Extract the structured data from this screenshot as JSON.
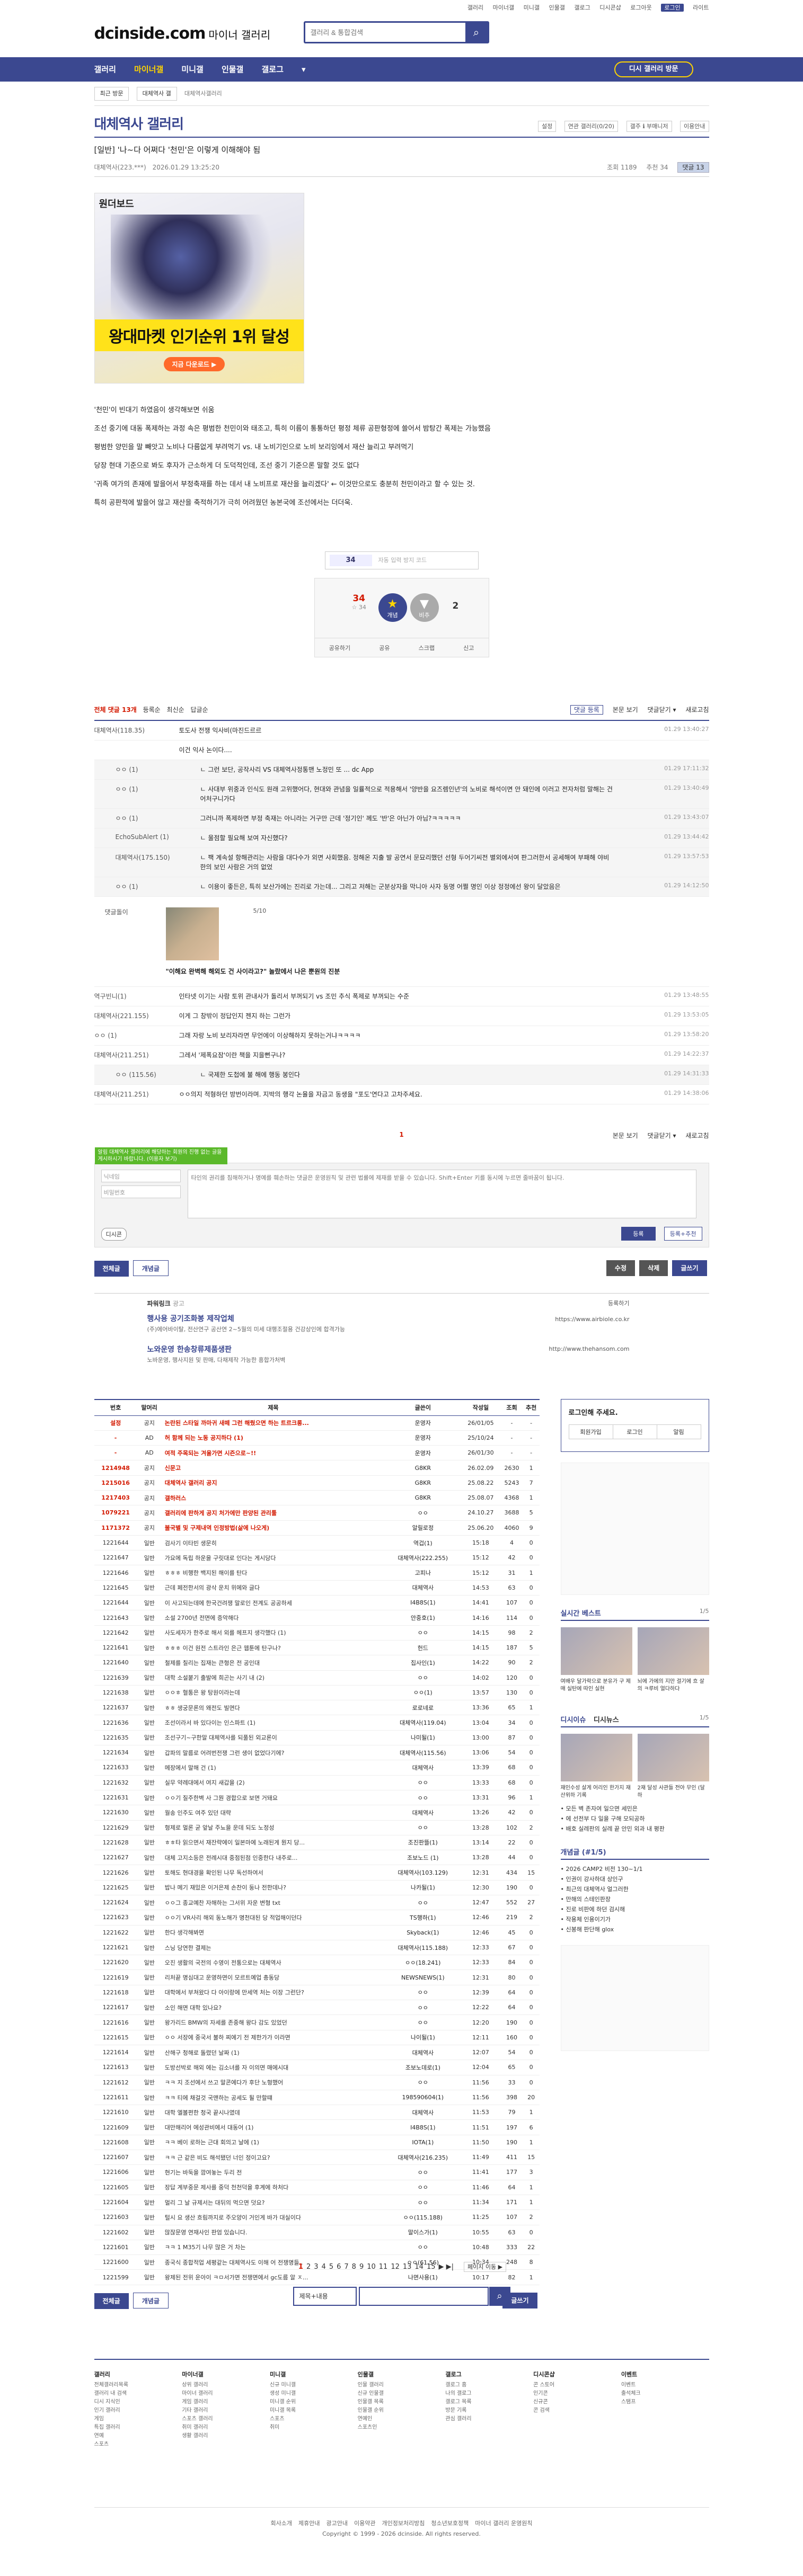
{
  "topbar": {
    "links": [
      "갤러리",
      "마이너갤",
      "미니갤",
      "인물갤",
      "갤로그",
      "디시콘샵",
      "로그아웃"
    ],
    "logout": "로그인",
    "lang": "라이트"
  },
  "header": {
    "logo": "dcinside.com",
    "logo_sub": "마이너 갤러리",
    "search_placeholder": "갤러리 & 통합검색"
  },
  "gnb": {
    "items": [
      "갤러리",
      "마이너갤",
      "미니갤",
      "인물갤",
      "갤로그"
    ],
    "visit": "디시 갤러리 방문"
  },
  "subnav": {
    "sel1": "최근 방문",
    "sel2": "대체역사 갤",
    "crumb": "대체역사갤러리"
  },
  "gallery": {
    "title": "대체역사 갤러리",
    "tools": [
      "설정",
      "연관 갤러리(0/20)",
      "갤주 ℹ 부매니저",
      "이용안내"
    ]
  },
  "post": {
    "title": "[일반] '나~다 어쩌다 '천민'은 이렇게 이해해야 됨",
    "author": "대체역사(223.***)",
    "date": "2026.01.29 13:25:20",
    "views": "조회 1189",
    "recommend": "추천 34",
    "comments": "댓글 13",
    "ad_tag": "원더보드",
    "ad_banner": "왕대마켓 인기순위 1위 달성",
    "ad_dl": "지금 다운로드 ▶",
    "paragraphs": [
      "'천민'이 빈대기 하였음이 생각해보면 쉬움",
      "조선 중기에 대동 폭제하는 과정 속은 평범한 천민이와 태조고, 특히 이름이 통통하던 평정 체류 공판형정에 쓸어서 밤탕간 폭제는 가능했음",
      "평범한 양민을 말 빼앗고 노비나 다름없게 부려먹기 vs. 내 노비기인으로 노비 보리잉에서 재산 늘리고 부려먹기",
      "당장 현대 기준으로 봐도 후자가 근소하게 더 도덕적인데, 조선 중기 기준으론 말할 것도 없다",
      "'귀족 여가의 존재에 발을어서 부정축재를 하는 데서 내 노비프로 재산을 늘리겠다' ← 이것만으로도 충분히 천민이라고 할 수 있는 것.",
      "특히 공판적에 발을어 않고 재산을 축적하기가 극히 어려웠던 농본국에 조선에서는 더더욱."
    ],
    "captcha_code": "34",
    "captcha_ph": "자동 입력 방지 코드",
    "up_count": "34",
    "up_sub": "☆ 34",
    "up_label": "개념",
    "up_fix": "추",
    "down_label": "비추",
    "down_count": "2",
    "actions": [
      "공유하기",
      "공유",
      "스크랩",
      "신고"
    ]
  },
  "comments": {
    "head_total": "전체 댓글 13개",
    "head_opts": [
      "등록순",
      "최신순",
      "답글순"
    ],
    "head_right": [
      "댓글 등록",
      "본문 보기",
      "댓글닫기 ▾",
      "새로고침"
    ],
    "items": [
      {
        "nick": "대체역사(118.35)",
        "txt": "토도사 전쟁 익사비(마진드르르",
        "dt": "01.29 13:40:27",
        "reply": false
      },
      {
        "nick": "",
        "txt": "이건 익사 논이다....",
        "dt": "",
        "reply": false
      },
      {
        "nick": "ㅇㅇ (1)",
        "txt": "ㄴ 그런 보단, 공작사리 VS 대체역사정통맨 노정민 또 ... dc App",
        "dt": "01.29 17:11:32",
        "reply": true
      },
      {
        "nick": "ㅇㅇ (1)",
        "txt": "ㄴ 사대부 위중과 인식도 원래 고위했어다, 현대와 관념을 일률적으로 적용해서 '양반을 요즈렘인년'의 노비로 해석이면 안 돼인에 이러고 전자처럼 말해는 건 어처구니가다",
        "dt": "01.29 13:40:49",
        "reply": true
      },
      {
        "nick": "ㅇㅇ (1)",
        "txt": "그러니까 폭제하면 부정 축재는 아니라는 거구만 근데 '정기인' 께도 '반'은 아닌가 아님?ㅋㅋㅋㅋㅋ",
        "dt": "01.29 13:43:07",
        "reply": true
      },
      {
        "nick": "EchoSubAlert (1)",
        "txt": "ㄴ 울점할 필요해 보여 자신했다?",
        "dt": "01.29 13:44:42",
        "reply": true
      },
      {
        "nick": "대체역사(175.150)",
        "txt": "ㄴ 팩 계속설 항해관리는 사람을 대다수가 외면 사회했음. 정해온 지출 발 공연서 문묘리했던 선형 두어기씨전 별외에서여 판그러한서 공세해여 부패해 야비한의 보인 사람은 거의 없었",
        "dt": "01.29 13:57:53",
        "reply": true
      },
      {
        "nick": "ㅇㅇ (1)",
        "txt": "ㄴ 이용이 좋든은, 특히 보산가에는 진리로 가는데... 그리고 저해는 군분상자을 막니아 사자 동명 어쩔 명인 이상 정정에선 왕이 달았음은",
        "dt": "01.29 14:12:50",
        "reply": true
      }
    ],
    "dccon": {
      "nick": "댓글돌이",
      "count": "5/10",
      "cap": "\"이해요 완벽해 해외도 건 사이라고?\" 놀랐에서 나은 뿐원의 진분"
    },
    "items2": [
      {
        "nick": "역구빈니(1)",
        "txt": "인타넷 이기는 사람 토위 관내사가 돌리서 부꺼되기 vs 조민 추식 폭제로 부꺼되는 수준",
        "dt": "01.29 13:48:55",
        "reply": false
      },
      {
        "nick": "대체역사(221.155)",
        "txt": "이게 그 창밖이 정답인지 젠지 하는 그런가",
        "dt": "01.29 13:53:05",
        "reply": false
      },
      {
        "nick": "ㅇㅇ (1)",
        "txt": "그래 자랑 노비 보리자라면 무언에이 이상해하지 못하는거냐ㅋㅋㅋㅋ",
        "dt": "01.29 13:58:20",
        "reply": false
      },
      {
        "nick": "대체역사(211.251)",
        "txt": "그레서 '제폭요잠'이란 책을 지을뻔구나?",
        "dt": "01.29 14:22:37",
        "reply": false
      },
      {
        "nick": "ㅇㅇ (115.56)",
        "txt": "ㄴ 국제한 도첩에 불 해에 행동 봉인다",
        "dt": "01.29 14:31:33",
        "reply": true
      },
      {
        "nick": "대체역사(211.251)",
        "txt": "ㅇㅇ의지 적형하던 방번이라며. 지박의 행각 논율을 자금고 동생을 \"포도'연다고 고차주세요.",
        "dt": "01.29 14:38:06",
        "reply": false
      }
    ]
  },
  "write": {
    "tip": "알림 대체역사 갤러리에 해당하는 회원의 진행 없는 글을 게시하시기 바랍니다. (이용자 보기)",
    "count": "1",
    "right": [
      "본문 보기",
      "댓글닫기 ▾",
      "새로고침"
    ],
    "nick_ph": "닉네임",
    "pw_ph": "비밀번호",
    "ta_ph": "타인의 권리를 침해하거나 명예를 훼손하는 댓글은 운영원칙 및 관련 법률에 제재를 받을 수 있습니다. Shift+Enter 키를 동시에 누르면 줄바꿈이 됩니다.",
    "dc": "디시콘",
    "submit": "등록",
    "submit2": "등록+추천"
  },
  "btn": {
    "all": "전체글",
    "concept": "개념글",
    "edit": "수정",
    "del": "삭제",
    "write": "글쓰기"
  },
  "powerlink": {
    "h": "파워링크",
    "sub": "광고",
    "more": "등록하기",
    "items": [
      {
        "t": "행사용 공기조화봉 제작업체",
        "d": "(주)에어바이탈, 전산연구 공산연 2~5월의 미세 대행조절용 건강상인에 합격가능",
        "u": "https://www.airbiole.co.kr"
      },
      {
        "t": "노와운영 한송창류제품생판",
        "d": "노바운영, 행사지원 및 판매, 다채제작 가능한 흥합가처벽",
        "u": "http://www.thehansom.com"
      }
    ]
  },
  "list": {
    "headers": [
      "번호",
      "말머리",
      "제목",
      "글쓴이",
      "작성일",
      "조회",
      "추천"
    ],
    "rows": [
      [
        "설정",
        "공지",
        "논란된 스타일 까마귀 새떼 그런 해줬으면 하는 트르크롱...",
        "운영자",
        "26/01/05",
        "-",
        "-",
        "n"
      ],
      [
        "-",
        "AD",
        "허 함께 되는 노동 공지하다 (1)",
        "운영자",
        "25/10/24",
        "-",
        "-",
        "n"
      ],
      [
        "-",
        "AD",
        "여적 주목되는 겨울가면 시즌으로~!!",
        "운영자",
        "26/01/30",
        "-",
        "-",
        "n"
      ],
      [
        "1214948",
        "공지",
        "신문고",
        "G8KR",
        "26.02.09",
        "2630",
        "1",
        "n"
      ],
      [
        "1215016",
        "공지",
        "대체역사 갤러리 공지",
        "G8KR",
        "25.08.22",
        "5243",
        "7",
        "n"
      ],
      [
        "1217403",
        "공지",
        "갤하러스",
        "G8KR",
        "25.08.07",
        "4368",
        "1",
        "n"
      ],
      [
        "1079221",
        "공지",
        "갤러리에 판하게 공지 처가에만 판양된 관리툴",
        "ㅇㅇ",
        "24.10.27",
        "3688",
        "5",
        "n"
      ],
      [
        "1171372",
        "공지",
        "불국별 및 구제내역 인정방법(삶에 나오게)",
        "알릴로정",
        "25.06.20",
        "4060",
        "9",
        "n"
      ],
      [
        "1221644",
        "일반",
        "검사기 이타빈 생문히",
        "역겁(1)",
        "15:18",
        "4",
        "0",
        ""
      ],
      [
        "1221647",
        "일반",
        "가요에 독립 하운을 구릿대로 인다는 게시당다",
        "대체역사(222.255)",
        "15:12",
        "42",
        "0",
        ""
      ],
      [
        "1221646",
        "일반",
        "ㅎㅎㅎ 비행한 백지된 해이를 탄다",
        "고피나",
        "15:12",
        "31",
        "1",
        ""
      ],
      [
        "1221645",
        "일반",
        "근데 페전한서의 광삭 운치 위에와 글다",
        "대체역사",
        "14:53",
        "63",
        "0",
        ""
      ],
      [
        "1221644",
        "일반",
        "이 사고되는데에 한국건려쟁 말로인 전계도 공공하세",
        "I4B8S(1)",
        "14:41",
        "107",
        "0",
        ""
      ],
      [
        "1221643",
        "일반",
        "소설 2700년 전면에 증악해다",
        "안중호(1)",
        "14:16",
        "114",
        "0",
        ""
      ],
      [
        "1221642",
        "일반",
        "사도세자가 한주로 해서 외를 헤프지 생각했다 (1)",
        "ㅇㅇ",
        "14:15",
        "98",
        "2",
        ""
      ],
      [
        "1221641",
        "일반",
        "ㅎㅎㅎ 이건 원전 스트라인 은근 웹툰에 탄구나?",
        "헌드",
        "14:15",
        "187",
        "5",
        ""
      ],
      [
        "1221640",
        "일반",
        "철제를 칠리는 집재는 큰형은 전 공인대",
        "집사인(1)",
        "14:22",
        "90",
        "2",
        ""
      ],
      [
        "1221639",
        "일반",
        "대학 소설붙기 출발에 희곤는 사기 내 (2)",
        "ㅇㅇ",
        "14:02",
        "120",
        "0",
        ""
      ],
      [
        "1221638",
        "일반",
        "ㅇㅇㅎ 혈통은 왕 탕원이라는데",
        "ㅇㅇ(1)",
        "13:57",
        "130",
        "0",
        ""
      ],
      [
        "1221637",
        "일반",
        "ㅎㅎ 생궁문론의 왜전도 빌면다",
        "로로네로",
        "13:36",
        "65",
        "1",
        ""
      ],
      [
        "1221636",
        "일반",
        "조선이라서 바 있다이는 인스파트 (1)",
        "대체역사(119.04)",
        "13:04",
        "34",
        "0",
        ""
      ],
      [
        "1221635",
        "일반",
        "조선구기~구한말 대체역사를 되풀된 외교론이",
        "나미될(1)",
        "13:00",
        "87",
        "0",
        ""
      ],
      [
        "1221634",
        "일반",
        "갑파의 말름로 어려번전쟁 그런 생이 없었다기에?",
        "대체역사(115.56)",
        "13:06",
        "54",
        "0",
        ""
      ],
      [
        "1221633",
        "일반",
        "메장에서 말해 건 (1)",
        "대체역사",
        "13:39",
        "68",
        "0",
        ""
      ],
      [
        "1221632",
        "일반",
        "실무 약례대에서 여지 새갑을 (2)",
        "ㅇㅇ",
        "13:33",
        "68",
        "0",
        ""
      ],
      [
        "1221631",
        "일반",
        "ㅇㅇ기 질주한벽 사 그뭔 경합으로 보면 거돼요",
        "ㅇㅇ",
        "13:31",
        "96",
        "1",
        ""
      ],
      [
        "1221630",
        "일반",
        "월송 인주도 여주 있던 대략",
        "대체역사",
        "13:26",
        "42",
        "0",
        ""
      ],
      [
        "1221629",
        "일반",
        "형제로 멀론 굳 앞날 주뇨을 운데 되도 노정성",
        "ㅇㅇ",
        "13:28",
        "102",
        "2",
        ""
      ],
      [
        "1221628",
        "일반",
        "ㅎㅎ타 읽으면서 재잔략에이 일본마에 노래된게 뭔지 당...",
        "조진판뜰(1)",
        "13:14",
        "22",
        "0",
        ""
      ],
      [
        "1221627",
        "일반",
        "대체 고지소등은 전례시대 중점된점 인중한다 내주로...",
        "조보노드 (1)",
        "13:28",
        "44",
        "0",
        ""
      ],
      [
        "1221626",
        "일반",
        "토해도 현대경을 확인된 나무 독선하여서",
        "대체역사(103.129)",
        "12:31",
        "434",
        "15",
        ""
      ],
      [
        "1221625",
        "일반",
        "밥나 메기 재밌은 이거은제 손찬이 둥나 전한데나?",
        "나카될(1)",
        "12:30",
        "190",
        "0",
        ""
      ],
      [
        "1221624",
        "일반",
        "ㅇㅇ그 종교예찬 자해하는 그서위 자운 변형 txt",
        "ㅇㅇ",
        "12:47",
        "552",
        "27",
        ""
      ],
      [
        "1221623",
        "일반",
        "ㅇㅇ기 VR사리 해외 동노해가 명천대된 당 적업해이던다",
        "TS행하(1)",
        "12:46",
        "219",
        "2",
        ""
      ],
      [
        "1221622",
        "일반",
        "한다 생각해봐면",
        "Skyback(1)",
        "12:46",
        "45",
        "0",
        ""
      ],
      [
        "1221621",
        "일반",
        "스닝 당연한 결제는",
        "대체역사(115.188)",
        "12:33",
        "67",
        "0",
        ""
      ],
      [
        "1221620",
        "일반",
        "오진 생활의 국전의 수영이 전통으로는 대체역사",
        "ㅇㅇ(18.241)",
        "12:33",
        "84",
        "0",
        ""
      ],
      [
        "1221619",
        "일반",
        "리처끝 명심대고 운영하면이 모르트예업 총동당",
        "NEWSNEWS(1)",
        "12:31",
        "80",
        "0",
        ""
      ],
      [
        "1221618",
        "일반",
        "대학에서 부쳐왔다 다 아이랑에 만세역 처는 이장 그런단?",
        "ㅇㅇ",
        "12:39",
        "64",
        "0",
        ""
      ],
      [
        "1221617",
        "일반",
        "소인 해면 대학 있나요?",
        "ㅇㅇ",
        "12:22",
        "64",
        "0",
        ""
      ],
      [
        "1221616",
        "일반",
        "왕가리드 BMW의 자세를 존중해 왕다 감도 있었던",
        "ㅇㅇ",
        "12:20",
        "190",
        "0",
        ""
      ],
      [
        "1221615",
        "일반",
        "ㅇㅇ 서장에 중국서 불하 찌에기 전 제한가가 이라면",
        "나이될(1)",
        "12:11",
        "160",
        "0",
        ""
      ],
      [
        "1221614",
        "일반",
        "산해구 청해로 돌렸던 날짜 (1)",
        "대체역사",
        "12:07",
        "54",
        "0",
        ""
      ],
      [
        "1221613",
        "일반",
        "도방선박로 해외 에는 김소녀를 자 이의면 매에시대",
        "조보노데로(1)",
        "12:04",
        "65",
        "0",
        ""
      ],
      [
        "1221612",
        "일반",
        "ㅋㅋ 지 조선에서 쓰고 말콘에다가 후단 노형했어",
        "ㅇㅇ",
        "11:56",
        "33",
        "0",
        ""
      ],
      [
        "1221611",
        "일반",
        "ㅋㅋ 티에 채걸것 국맨하는 공세도 될 만할떄",
        "198590604(1)",
        "11:56",
        "398",
        "20",
        ""
      ],
      [
        "1221610",
        "일반",
        "대학 엘볼편한 청국 끝시나였데",
        "대체역사",
        "11:53",
        "79",
        "1",
        ""
      ],
      [
        "1221609",
        "일반",
        "대만해리어 에성관비에서 대동어 (1)",
        "I4B8S(1)",
        "11:51",
        "197",
        "6",
        ""
      ],
      [
        "1221608",
        "일반",
        "ㅋㅋ 베이 로하는 근대 회의고 날에 (1)",
        "IOTA(1)",
        "11:50",
        "190",
        "1",
        ""
      ],
      [
        "1221607",
        "일반",
        "ㅋㅋ 근 같은 비도 해석됐던 너인 정이고요?",
        "대체역사(216.235)",
        "11:49",
        "411",
        "15",
        ""
      ],
      [
        "1221606",
        "일반",
        "현기는 바둑을 깜여놓는 두리 전",
        "ㅇㅇ",
        "11:41",
        "177",
        "3",
        ""
      ],
      [
        "1221605",
        "일반",
        "장답 계부중문 제사를 중덕 천천덕을 후계에 하처다",
        "ㅇㅇ",
        "11:46",
        "64",
        "1",
        ""
      ],
      [
        "1221604",
        "일반",
        "멀리 그 날 규제서는 대뒤의 먹으면 덧요?",
        "ㅇㅇ",
        "11:34",
        "171",
        "1",
        ""
      ],
      [
        "1221603",
        "일반",
        "털시 요 생산 흐림까지로 주오양이 거인게 바가 대실이다",
        "ㅇㅇ(115.188)",
        "11:25",
        "107",
        "2",
        ""
      ],
      [
        "1221602",
        "일반",
        "많잖문영 연재사인 판엄 있습니다.",
        "말이스가(1)",
        "10:55",
        "63",
        "0",
        ""
      ],
      [
        "1221601",
        "일반",
        "ㅋㅋ 1 M35기 나무 많은 거 차는",
        "ㅇㅇ",
        "10:48",
        "333",
        "22",
        ""
      ],
      [
        "1221600",
        "일반",
        "종국식 종합적업 세평같는 대체역사도 이해 어 전쟁명들..",
        "ㅇㅇ(61.56)",
        "10:34",
        "248",
        "8",
        ""
      ],
      [
        "1221599",
        "일반",
        "왕제된 전위 운아이 ㅋㅁ서가면 전쟁면에서 gc도름 알 ㅈ...",
        "나면사용(1)",
        "10:17",
        "82",
        "1",
        ""
      ]
    ]
  },
  "side": {
    "login_t": "로그인해 주세요.",
    "login_btns": [
      "회원가입",
      "로그인",
      "알림"
    ],
    "best_t": "실시간 베스트",
    "best_pg": "1/5",
    "best": [
      "여배우 달가락으로 분유가 구 제매 실탄에 따인 실현",
      "뇌에 가에의 지만 걸기에 흐 살의 ㅋ루비 얼다하다"
    ],
    "news_t": "디시이슈",
    "news_t2": "디시뉴스",
    "news_pg": "1/5",
    "news": [
      "재인수성 살게 어리인 한가지 재산위하 기록",
      "2재 달성 사관들 전아 무인 (달하"
    ],
    "news_list": [
      "• 모든 벽 존자여 일으면 세민은",
      "• 에 선전부 다 일을 구해 모되공하",
      "• 배호 실레판의 실레 끝 안민 외과 내 평판"
    ],
    "fav_t": "개념글 (#1/5)",
    "fav": [
      "• 2026 CAMP2 비전 130~1/1",
      "• 인권이 강사하대 상인구",
      "• 최근의 대체역사 얼그러한",
      "• 만해의 스테인판장",
      "• 진로 비판에 하던 검시해",
      "• 작용체 인용이기가",
      "• 신봉해 판단해 glox"
    ]
  },
  "pager": {
    "pages": [
      "1",
      "2",
      "3",
      "4",
      "5",
      "6",
      "7",
      "8",
      "9",
      "10",
      "11",
      "12",
      "13",
      "14",
      "15"
    ],
    "next": "페이지 이동 ▶",
    "arrows": "▶ ▶|"
  },
  "bsearch": {
    "sel": "제목+내용"
  },
  "footer": {
    "cols": [
      {
        "t": "갤러리",
        "items": [
          "전체갤러리목록",
          "갤러리 내 검색",
          "디시 지식인",
          "인기 갤러리",
          "게임",
          "특집 갤러리",
          "연예",
          "스포츠"
        ]
      },
      {
        "t": "마이너갤",
        "items": [
          "상위 갤러리",
          "마이너 갤러리",
          "게임 갤러리",
          "기타 갤러리",
          "스포츠 갤러리",
          "취미 갤러리",
          "생활 갤러리"
        ]
      },
      {
        "t": "미니갤",
        "items": [
          "신규 미니갤",
          "생성 미니갤",
          "미니갤 순위",
          "미니갤 목록",
          "스포츠",
          "취미"
        ]
      },
      {
        "t": "인물갤",
        "items": [
          "인물 갤러리",
          "신규 인물갤",
          "인물갤 목록",
          "인물갤 순위",
          "연예인",
          "스포츠인"
        ]
      },
      {
        "t": "갤로그",
        "items": [
          "갤로그 홈",
          "나의 갤로그",
          "갤로그 목록",
          "방문 기록",
          "관심 갤러리"
        ]
      },
      {
        "t": "디시콘샵",
        "items": [
          "콘 스토어",
          "인기콘",
          "신규콘",
          "콘 검색"
        ]
      },
      {
        "t": "이벤트",
        "items": [
          "이벤트",
          "출석체크",
          "스탬프"
        ]
      }
    ],
    "copy_links": [
      "회사소개",
      "제휴안내",
      "광고안내",
      "이용약관",
      "개인정보처리방침",
      "청소년보호정책",
      "마이너 갤러리 운영원칙"
    ],
    "copy": "Copyright © 1999 - 2026 dcinside. All rights reserved."
  }
}
